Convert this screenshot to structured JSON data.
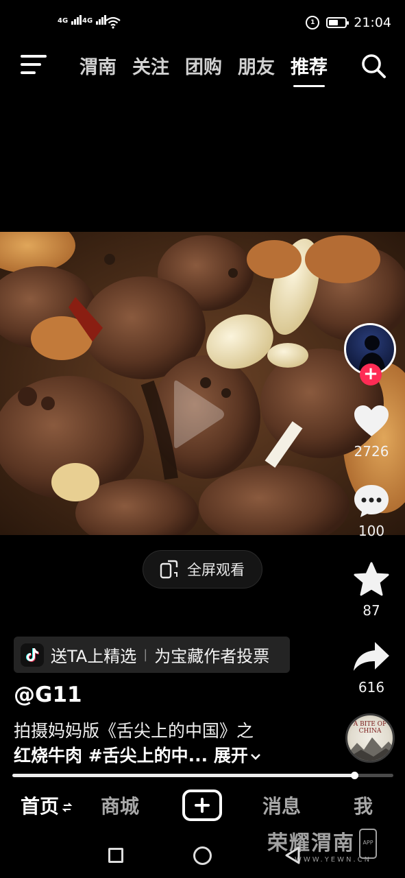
{
  "status_bar": {
    "sim1": "4G",
    "sim2": "4G",
    "time": "21:04",
    "battery_level": 0.6,
    "alarm_label": "1"
  },
  "top_nav": {
    "tabs": [
      {
        "label": "渭南",
        "active": false
      },
      {
        "label": "关注",
        "active": false
      },
      {
        "label": "团购",
        "active": false
      },
      {
        "label": "朋友",
        "active": false
      },
      {
        "label": "推荐",
        "active": true
      }
    ]
  },
  "video": {
    "fullscreen_label": "全屏观看"
  },
  "actions": {
    "likes": "2726",
    "comments": "100",
    "favorites": "87",
    "shares": "616"
  },
  "info": {
    "promo_left": "送TA上精选",
    "promo_right": "为宝藏作者投票",
    "author": "@G11",
    "description_line1": "拍摄妈妈版《舌尖上的中国》之",
    "description_line2": "红烧牛肉 #舌尖上的中...",
    "expand_label": "展开",
    "music_disc_title": "A BITE OF CHINA"
  },
  "playback": {
    "progress": 0.897
  },
  "bottom_nav": {
    "home": "首页",
    "mall": "商城",
    "messages": "消息",
    "me": "我"
  },
  "watermark": {
    "main": "荣耀渭南",
    "sub": "WWW.YEWN.CN",
    "app": "APP"
  },
  "colors": {
    "accent": "#fe2c55",
    "background": "#000000"
  }
}
